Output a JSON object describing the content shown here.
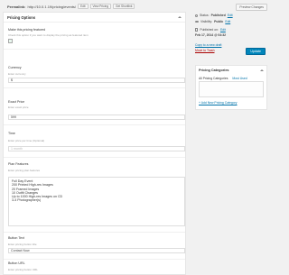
{
  "permalink": {
    "label": "Permalink:",
    "url": "http://10.0.1.19/pricing/events/",
    "edit_label": "Edit",
    "view_label": "View Pricing",
    "shortlink_label": "Get Shortlink"
  },
  "panel": {
    "title": "Pricing Options",
    "fields": {
      "featured": {
        "label": "Make this pricing featured",
        "desc": "Check this option if you want to display the pricing as featured item"
      },
      "currency": {
        "label": "Currency",
        "desc": "Enter currency",
        "value": "$"
      },
      "exact_price": {
        "label": "Exact Price",
        "desc": "Enter exact price",
        "value": "599"
      },
      "time": {
        "label": "Time",
        "desc": "Enter price per time (Optional)",
        "placeholder": "1 month"
      },
      "plan_features": {
        "label": "Plan Features",
        "desc": "Enter pricing plan features",
        "lines": [
          "Full Day Event",
          "200 Printed High-res Images",
          "20 Framed Images",
          "10 Outfit Changes",
          "Up to 1000 High-res Images on CD",
          "3-4 Photographer(s)"
        ]
      },
      "button_text": {
        "label": "Button Text",
        "desc": "Enter pricing button title",
        "value": "Contact Now"
      },
      "button_url": {
        "label": "Button URL",
        "desc": "Enter pricing button URL"
      }
    }
  },
  "publish": {
    "preview_label": "Preview Changes",
    "status_label": "Status:",
    "status_value": "Published",
    "status_edit": "Edit",
    "visibility_label": "Visibility:",
    "visibility_value": "Public",
    "visibility_edit": "Edit",
    "published_label": "Published on:",
    "published_value": "Feb 17, 2014 @ 04:32",
    "published_edit": "Edit",
    "copy_draft": "Copy to a new draft",
    "move_trash": "Move to Trash",
    "update_label": "Update"
  },
  "categories": {
    "title": "Pricing Categories",
    "tab_all": "All Pricing Categories",
    "tab_most": "Most Used",
    "add_new": "+ Add New Pricing Category"
  },
  "colors": {
    "link": "#0073aa",
    "primary_button": "#0085ba",
    "trash": "#a00000",
    "background": "#f1f1f1"
  }
}
